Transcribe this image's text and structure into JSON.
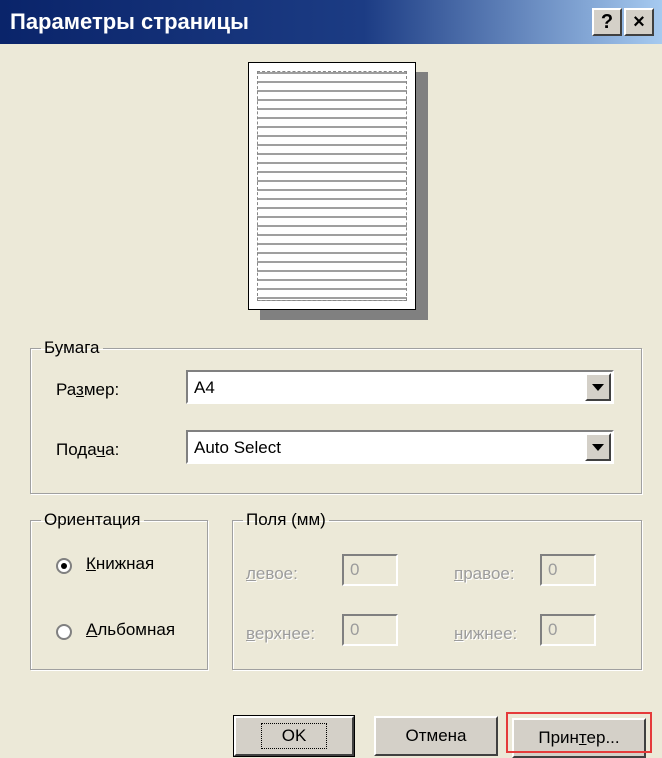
{
  "window": {
    "title": "Параметры страницы",
    "help_button": "?",
    "close_button": "×"
  },
  "paper": {
    "legend": "Бумага",
    "size_label": "Размер:",
    "size_value": "A4",
    "source_label": "Подача:",
    "source_value": "Auto Select"
  },
  "orientation": {
    "legend": "Ориентация",
    "portrait": "Книжная",
    "landscape": "Альбомная",
    "selected": "portrait"
  },
  "margins": {
    "legend": "Поля (мм)",
    "left_label": "левое:",
    "left_value": "0",
    "right_label": "правое:",
    "right_value": "0",
    "top_label": "верхнее:",
    "top_value": "0",
    "bottom_label": "нижнее:",
    "bottom_value": "0"
  },
  "buttons": {
    "ok": "OK",
    "cancel": "Отмена",
    "printer": "Принтер..."
  },
  "colors": {
    "highlight": "#e53b3b",
    "titlebar": "#0a246a"
  }
}
